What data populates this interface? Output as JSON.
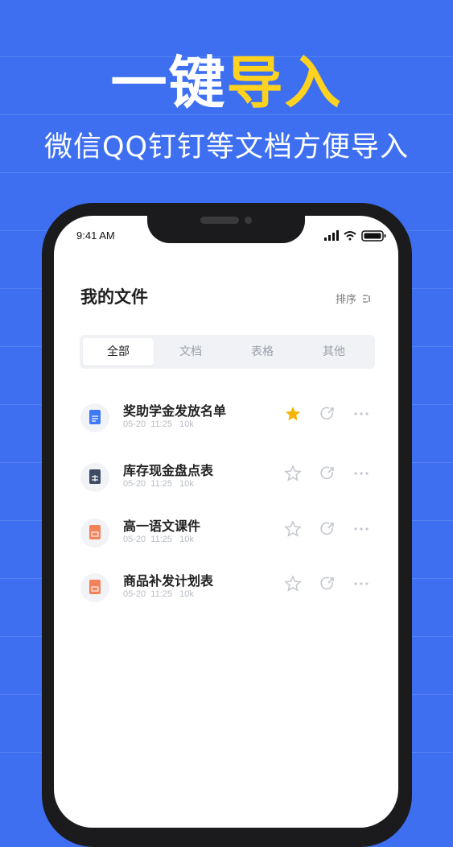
{
  "headline": {
    "part1": "一键",
    "part2": "导入"
  },
  "subline": "微信QQ钉钉等文档方便导入",
  "status": {
    "time": "9:41 AM"
  },
  "page": {
    "title": "我的文件",
    "sort_label": "排序"
  },
  "tabs": [
    {
      "label": "全部",
      "active": true
    },
    {
      "label": "文档",
      "active": false
    },
    {
      "label": "表格",
      "active": false
    },
    {
      "label": "其他",
      "active": false
    }
  ],
  "files": [
    {
      "name": "奖助学金发放名单",
      "date": "05-20",
      "time": "11:25",
      "size": "10k",
      "starred": true,
      "type": "doc"
    },
    {
      "name": "库存现金盘点表",
      "date": "05-20",
      "time": "11:25",
      "size": "10k",
      "starred": false,
      "type": "sheet"
    },
    {
      "name": "高一语文课件",
      "date": "05-20",
      "time": "11:25",
      "size": "10k",
      "starred": false,
      "type": "ppt"
    },
    {
      "name": "商品补发计划表",
      "date": "05-20",
      "time": "11:25",
      "size": "10k",
      "starred": false,
      "type": "ppt"
    }
  ],
  "colors": {
    "background": "#3d6ff0",
    "accent_yellow": "#ffd21f",
    "star_active": "#f5b400",
    "doc_blue": "#3d7af5",
    "sheet_dark": "#3d4b63",
    "ppt_orange": "#f2825a"
  },
  "icons": [
    "signal-icon",
    "wifi-icon",
    "battery-icon",
    "sort-icon",
    "star-icon",
    "share-icon",
    "more-icon",
    "doc-icon",
    "sheet-icon",
    "ppt-icon"
  ]
}
